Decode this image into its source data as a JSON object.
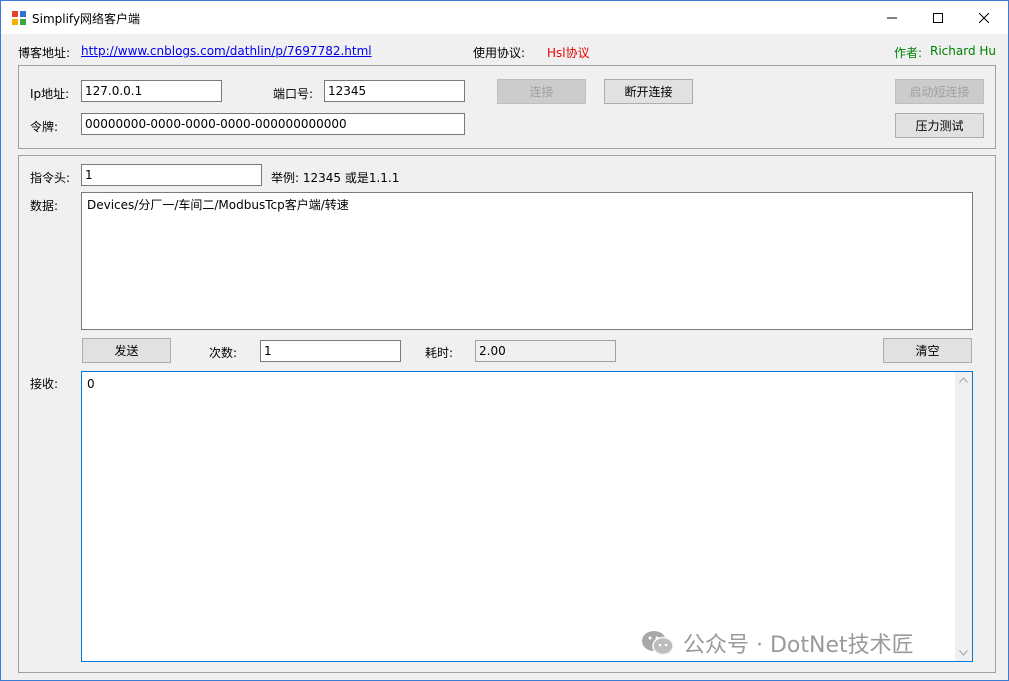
{
  "window": {
    "title": "Simplify网络客户端"
  },
  "header": {
    "blog_label": "博客地址:",
    "blog_url": "http://www.cnblogs.com/dathlin/p/7697782.html",
    "protocol_label": "使用协议:",
    "protocol_value": "Hsl协议",
    "author_label": "作者:",
    "author_value": "Richard Hu"
  },
  "connection": {
    "ip_label": "Ip地址:",
    "ip_value": "127.0.0.1",
    "port_label": "端口号:",
    "port_value": "12345",
    "connect_label": "连接",
    "disconnect_label": "断开连接",
    "short_conn_label": "启动短连接",
    "token_label": "令牌:",
    "token_value": "00000000-0000-0000-0000-000000000000",
    "stress_label": "压力测试"
  },
  "command": {
    "head_label": "指令头:",
    "head_value": "1",
    "example_text": "举例: 12345 或是1.1.1",
    "data_label": "数据:",
    "data_value": "Devices/分厂一/车间二/ModbusTcp客户端/转速",
    "send_label": "发送",
    "count_label": "次数:",
    "count_value": "1",
    "elapsed_label": "耗时:",
    "elapsed_value": "2.00",
    "clear_label": "清空",
    "receive_label": "接收:",
    "receive_value": "0"
  },
  "watermark": {
    "text": "公众号 · DotNet技术匠"
  }
}
